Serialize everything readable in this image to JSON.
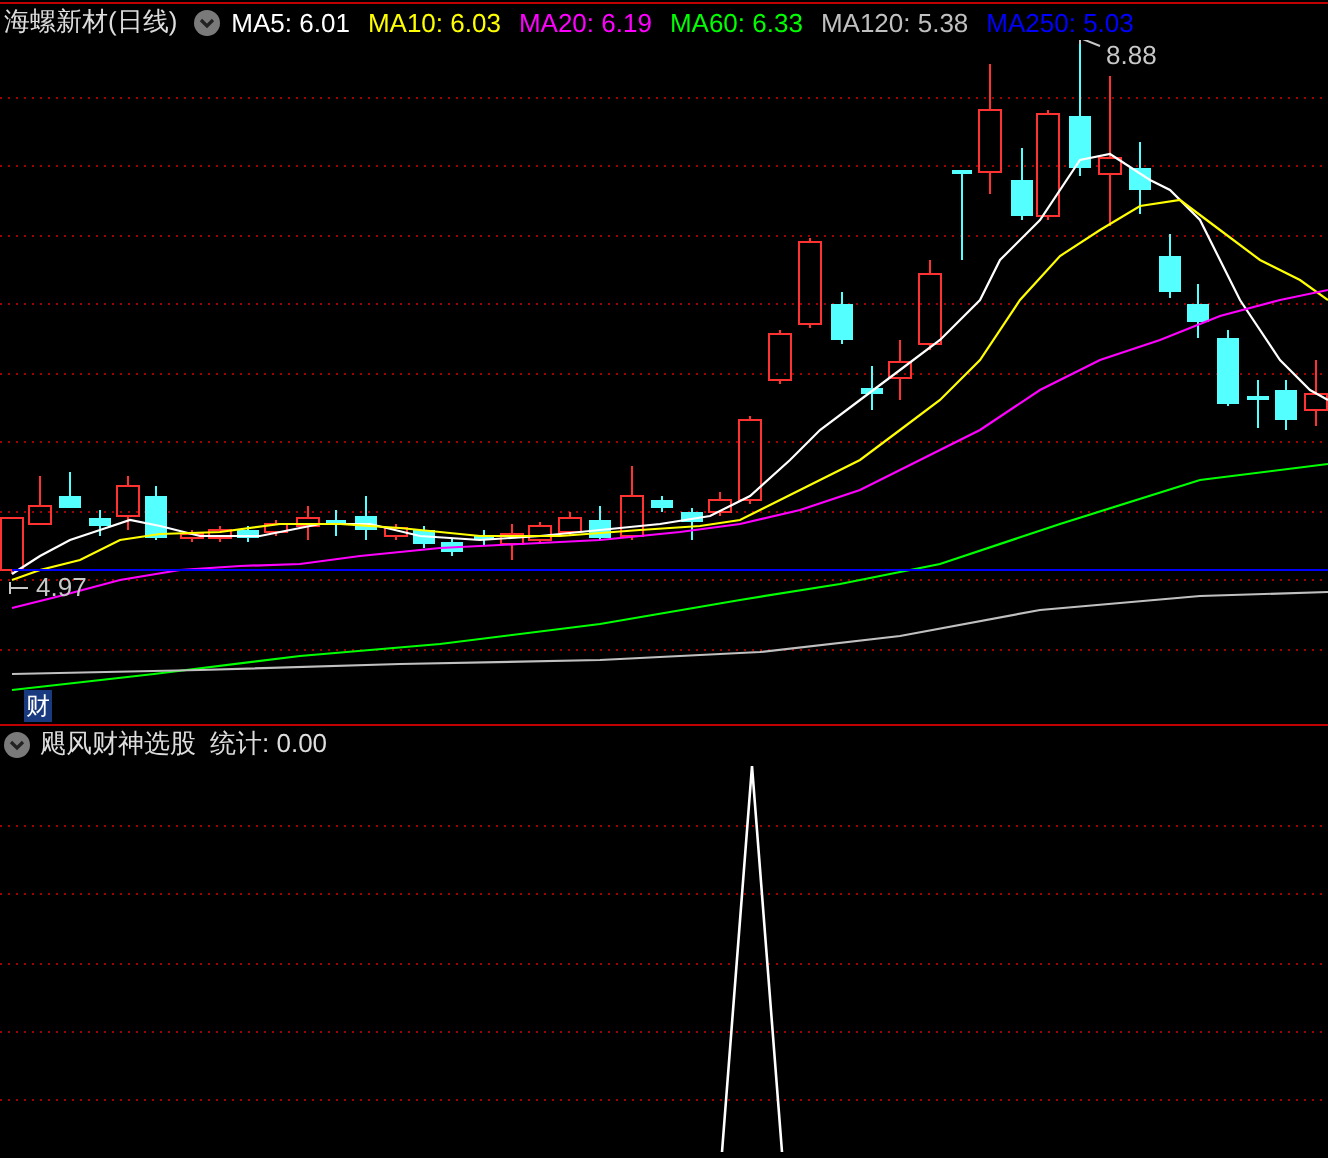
{
  "main_panel": {
    "title": "海螺新材(日线)",
    "indicators": [
      {
        "label": "MA5: 6.01",
        "color": "#ffffff"
      },
      {
        "label": "MA10: 6.03",
        "color": "#ffff00"
      },
      {
        "label": "MA20: 6.19",
        "color": "#ff00ff"
      },
      {
        "label": "MA60: 6.33",
        "color": "#00ff00"
      },
      {
        "label": "MA120: 5.38",
        "color": "#c0c0c0"
      },
      {
        "label": "MA250: 5.03",
        "color": "#0000ff"
      }
    ],
    "high_label": "8.88",
    "low_label": "4.97",
    "badge": "财"
  },
  "sub_panel": {
    "title": "飓风财神选股",
    "stat": "统计: 0.00"
  }
}
